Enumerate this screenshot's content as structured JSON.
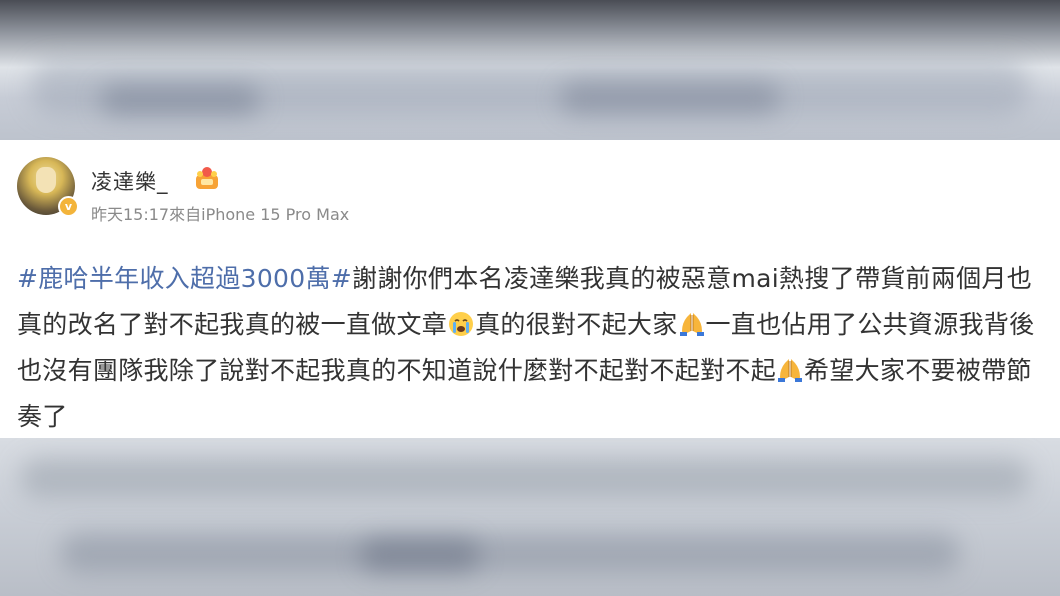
{
  "post": {
    "username": "凌達樂_",
    "time": "昨天15:17",
    "source_prefix": "來自",
    "device": "iPhone 15 Pro Max",
    "hashtag": "#鹿哈半年收入超過3000萬#",
    "text_1": "謝謝你們本名凌達樂我真的被惡意mai熱搜了帶貨前兩個月也真的改名了對不起我真的被一直做文章",
    "text_2": "真的很對不起大家",
    "text_3": "一直也佔用了公共資源我背後也沒有團隊我除了說對不起我真的不知道說什麼對不起對不起對不起",
    "text_4": "希望大家不要被帶節奏了",
    "icons": [
      "crying-emoji",
      "pray-emoji",
      "pray-emoji",
      "crown-icon",
      "verified-badge-icon"
    ],
    "colors": {
      "hashtag": "#4e6eaa",
      "text": "#333333",
      "meta": "#8a8a8a",
      "badge": "#f3b43b"
    }
  }
}
